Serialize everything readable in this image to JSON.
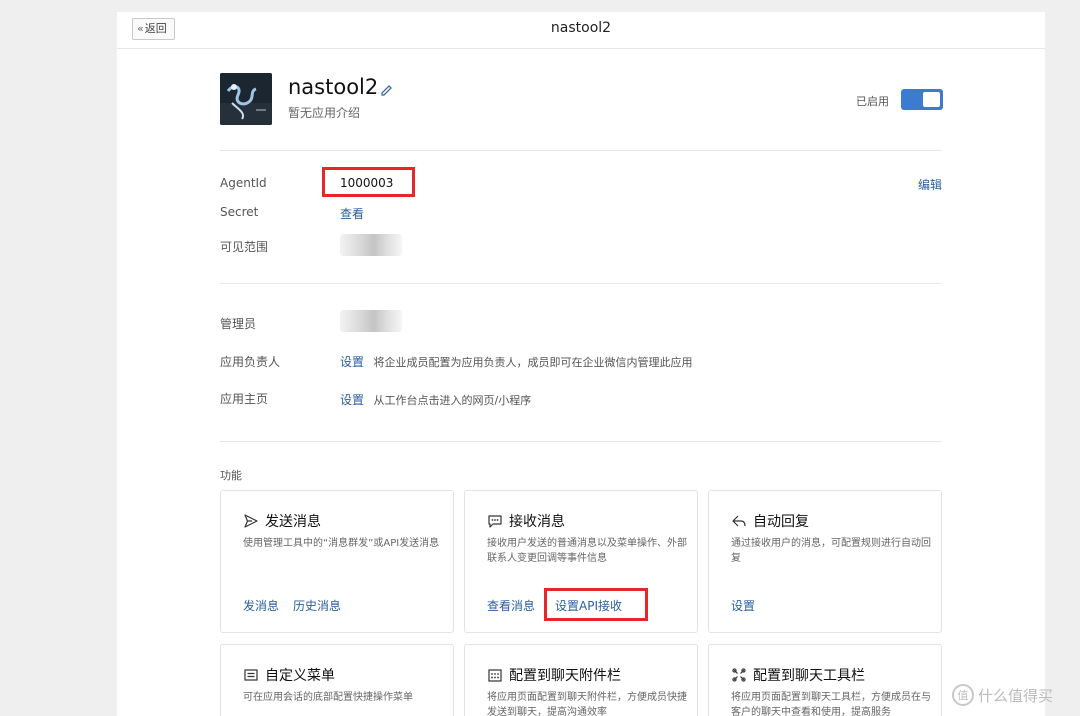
{
  "header": {
    "back_label": "返回",
    "title": "nastool2"
  },
  "app": {
    "name": "nastool2",
    "description": "暂无应用介绍",
    "status_label": "已启用",
    "enabled": true
  },
  "basic_info": {
    "agentid_label": "AgentId",
    "agentid_value": "1000003",
    "secret_label": "Secret",
    "secret_action": "查看",
    "visible_range_label": "可见范围",
    "edit_label": "编辑"
  },
  "management": {
    "admin_label": "管理员",
    "owner_label": "应用负责人",
    "owner_action": "设置",
    "owner_hint": "将企业成员配置为应用负责人，成员即可在企业微信内管理此应用",
    "homepage_label": "应用主页",
    "homepage_action": "设置",
    "homepage_hint": "从工作台点击进入的网页/小程序"
  },
  "features": {
    "section_label": "功能",
    "cards": [
      {
        "title": "发送消息",
        "desc": "使用管理工具中的“消息群发”或API发送消息",
        "actions": [
          "发消息",
          "历史消息"
        ],
        "icon": "send-icon"
      },
      {
        "title": "接收消息",
        "desc": "接收用户发送的普通消息以及菜单操作、外部联系人变更回调等事件信息",
        "actions": [
          "查看消息",
          "设置API接收"
        ],
        "icon": "chat-icon"
      },
      {
        "title": "自动回复",
        "desc": "通过接收用户的消息，可配置规则进行自动回复",
        "actions": [
          "设置"
        ],
        "icon": "reply-icon"
      },
      {
        "title": "自定义菜单",
        "desc": "可在应用会话的底部配置快捷操作菜单",
        "actions": [],
        "icon": "menu-icon"
      },
      {
        "title": "配置到聊天附件栏",
        "desc": "将应用页面配置到聊天附件栏，方便成员快捷发送到聊天，提高沟通效率",
        "actions": [],
        "icon": "attachment-icon"
      },
      {
        "title": "配置到聊天工具栏",
        "desc": "将应用页面配置到聊天工具栏，方便成员在与客户的聊天中查看和使用，提高服务",
        "actions": [],
        "icon": "toolbar-icon"
      }
    ]
  },
  "watermark": {
    "text": "什么值得买",
    "logo_char": "值"
  },
  "colors": {
    "accent": "#3d7bcf",
    "link": "#2a5e9e",
    "highlight": "#e8262a"
  }
}
